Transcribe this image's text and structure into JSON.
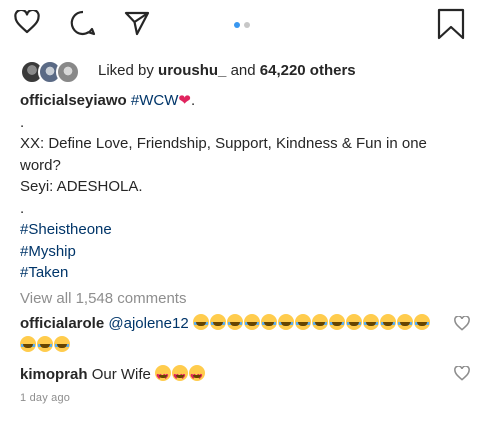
{
  "actions": {
    "like_icon": "heart-outline",
    "comment_icon": "speech-bubble",
    "share_icon": "paper-plane",
    "save_icon": "bookmark",
    "carousel": {
      "total": 2,
      "active": 1
    }
  },
  "likes": {
    "liked_by": "Liked by",
    "user": "uroushu_",
    "and_text": "and",
    "others": "64,220 others"
  },
  "caption": {
    "username": "officialseyiawo",
    "hashtag": "#WCW",
    "end_dot": ".",
    "sep1": ".",
    "question": "XX: Define Love, Friendship, Support, Kindness & Fun in one word?",
    "answer": "Seyi: ADESHOLA.",
    "sep2": ".",
    "tags": [
      "#Sheistheone",
      "#Myship",
      "#Taken"
    ]
  },
  "view_all": "View all 1,548 comments",
  "comments": [
    {
      "username": "officialarole",
      "mention": "@ajolene12",
      "laugh_count": 17
    },
    {
      "username": "kimoprah",
      "text": "Our Wife",
      "hearteyes_count": 3
    }
  ],
  "timestamp": "1 day ago"
}
